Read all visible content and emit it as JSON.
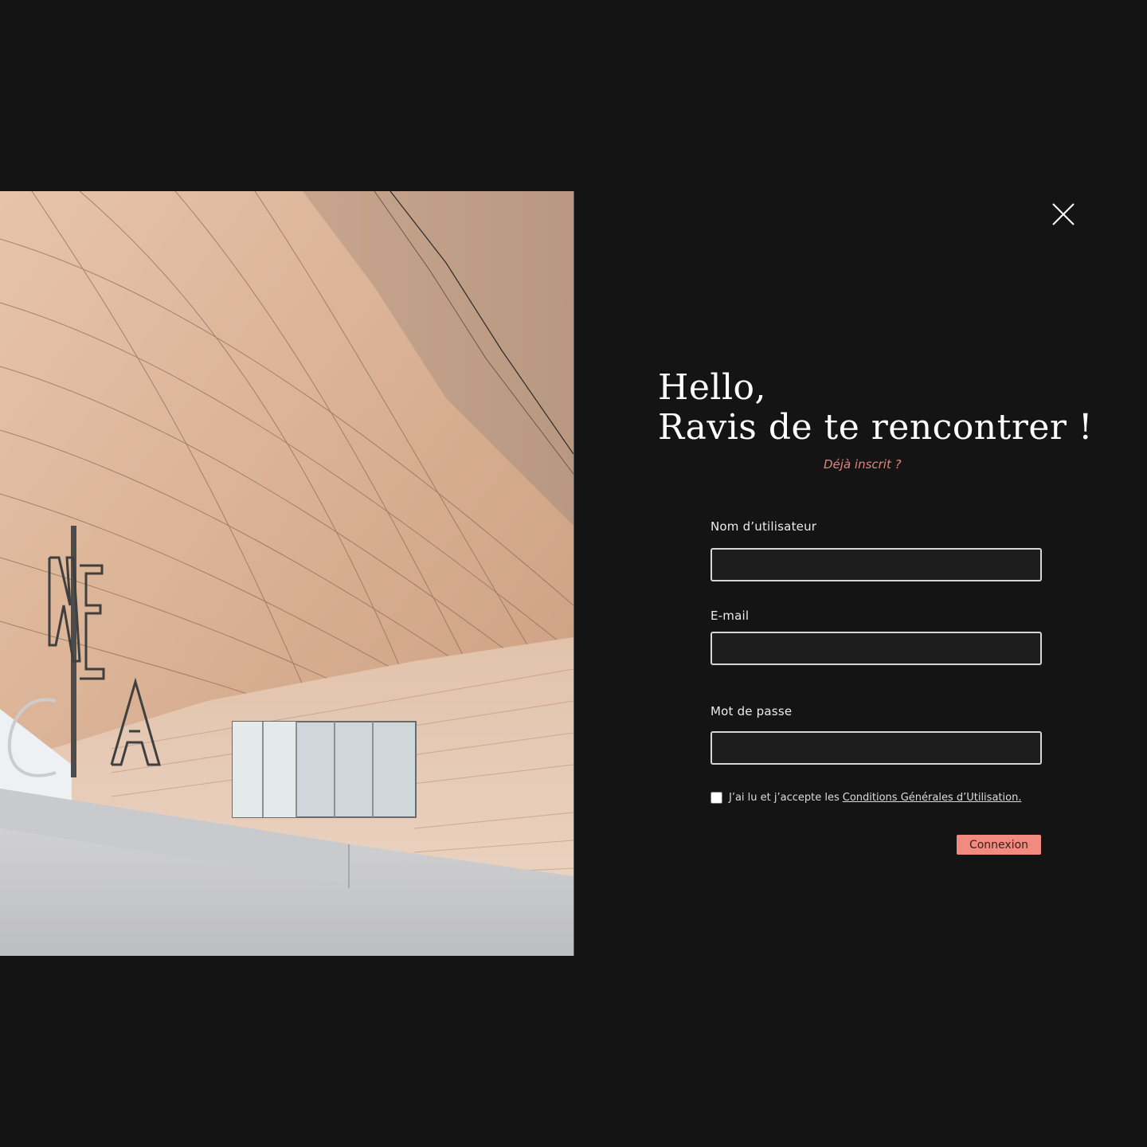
{
  "modal": {
    "close_label": "×",
    "photo_sign_letters": "MÉCA"
  },
  "heading": {
    "line1": "Hello,",
    "line2": "Ravis de te rencontrer !"
  },
  "already_registered": "Déjà inscrit ?",
  "form": {
    "username": {
      "label": "Nom d’utilisateur",
      "value": "",
      "placeholder": ""
    },
    "email": {
      "label": "E-mail",
      "value": "",
      "placeholder": ""
    },
    "password": {
      "label": "Mot de passe",
      "value": "",
      "placeholder": ""
    },
    "terms": {
      "text": "J’ai lu et j’accepte les",
      "link": "Conditions Générales d’Utilisation.",
      "checked": false
    },
    "submit_label": "Connexion"
  },
  "colors": {
    "background": "#141414",
    "accent": "#f28b7f",
    "link": "#e2857b",
    "input_border": "#d6d6d6"
  },
  "icons": {
    "close": "close-icon"
  }
}
